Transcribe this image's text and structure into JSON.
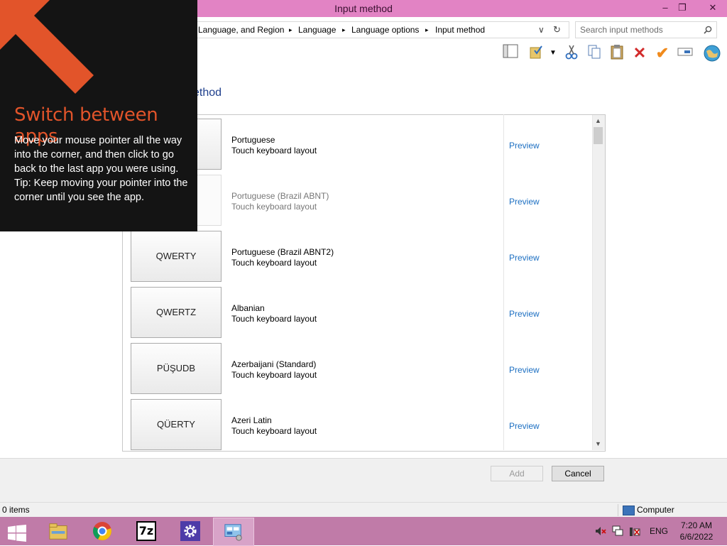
{
  "window": {
    "title": "Input method",
    "controls": {
      "minimize": "–",
      "restore": "❐",
      "close": "✕"
    }
  },
  "address": {
    "crumbs": [
      "Language, and Region",
      "Language",
      "Language options",
      "Input method"
    ],
    "separator": "▸",
    "dropdown": "∨",
    "refresh": "↻",
    "search_placeholder": "Search input methods"
  },
  "heading": "ethod",
  "list": {
    "rows": [
      {
        "key": "",
        "name": "Portuguese",
        "sub": "Touch keyboard layout",
        "preview": "Preview",
        "dim": false
      },
      {
        "key": "",
        "name": "Portuguese (Brazil ABNT)",
        "sub": "Touch keyboard layout",
        "preview": "Preview",
        "dim": true
      },
      {
        "key": "QWERTY",
        "name": "Portuguese (Brazil ABNT2)",
        "sub": "Touch keyboard layout",
        "preview": "Preview",
        "dim": false
      },
      {
        "key": "QWERTZ",
        "name": "Albanian",
        "sub": "Touch keyboard layout",
        "preview": "Preview",
        "dim": false
      },
      {
        "key": "PÜŞUDB",
        "name": "Azerbaijani (Standard)",
        "sub": "Touch keyboard layout",
        "preview": "Preview",
        "dim": false
      },
      {
        "key": "QÜERTY",
        "name": "Azeri Latin",
        "sub": "Touch keyboard layout",
        "preview": "Preview",
        "dim": false
      }
    ]
  },
  "buttons": {
    "add": "Add",
    "cancel": "Cancel"
  },
  "status": {
    "items": "0 items",
    "computer": "Computer"
  },
  "tray": {
    "lang": "ENG",
    "time": "7:20 AM",
    "date": "6/6/2022"
  },
  "taskbar": {
    "sevenzip": "7z"
  },
  "overlay": {
    "title": "Switch between apps",
    "body1": "Move your mouse pointer all the way into the corner, and then click to go back to the last app you were using.",
    "body2": "Tip: Keep moving your pointer into the corner until you see the app."
  },
  "colors": {
    "titlebar": "#e283c4",
    "taskbar": "#c07ba8",
    "overlay_bg": "#141414",
    "overlay_accent": "#e2542a",
    "link": "#1c6fc2"
  }
}
